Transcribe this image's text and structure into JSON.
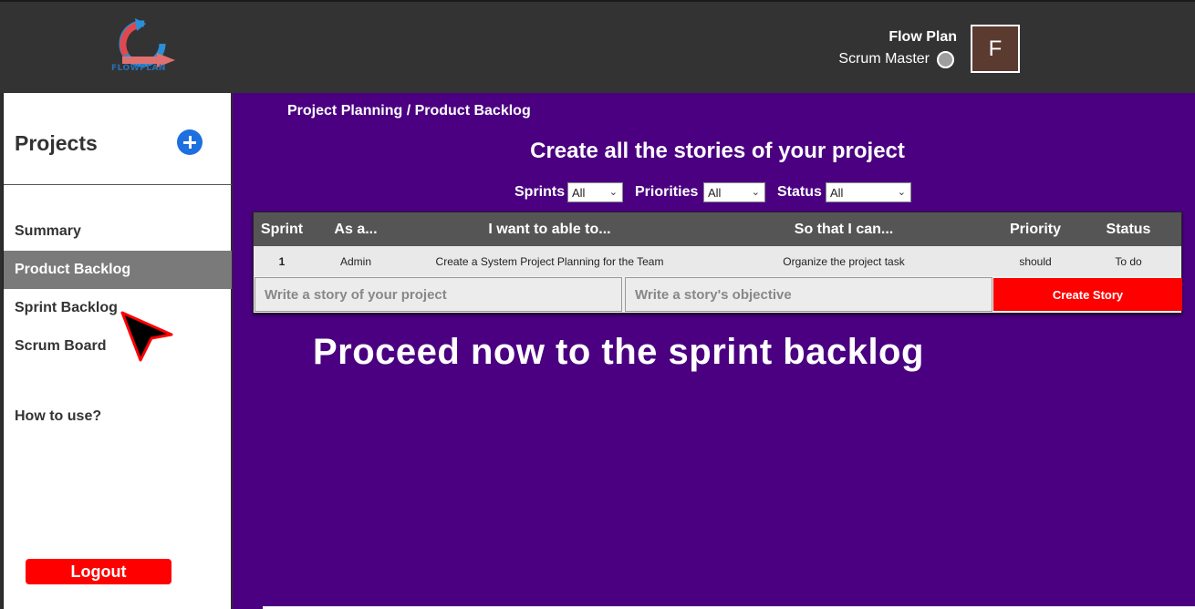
{
  "app": {
    "logo_text": "FLOWPLAN"
  },
  "header": {
    "user_name": "Flow Plan",
    "user_role": "Scrum Master",
    "avatar_letter": "F"
  },
  "sidebar": {
    "title": "Projects",
    "items": [
      {
        "label": "Summary"
      },
      {
        "label": "Product Backlog"
      },
      {
        "label": "Sprint Backlog"
      },
      {
        "label": "Scrum Board"
      }
    ],
    "how_to": "How to use?",
    "logout": "Logout"
  },
  "main": {
    "breadcrumb": "Project Planning / Product Backlog",
    "heading": "Create all the stories of your project",
    "filters": [
      {
        "label": "Sprints",
        "value": "All"
      },
      {
        "label": "Priorities",
        "value": "All"
      },
      {
        "label": "Status",
        "value": "All"
      }
    ],
    "table": {
      "columns": [
        "Sprint",
        "As a...",
        "I want to able to...",
        "So that I can...",
        "Priority",
        "Status"
      ],
      "rows": [
        [
          "1",
          "Admin",
          "Create a System Project Planning for the Team",
          "Organize the project task",
          "should",
          "To do"
        ]
      ]
    },
    "story_placeholder": "Write a story of your project",
    "objective_placeholder": "Write a story's objective",
    "create_button": "Create Story",
    "overlay_text": "Proceed now to the sprint backlog"
  },
  "colors": {
    "topbar": "#333333",
    "main_bg": "#4a0080",
    "accent_red": "#ff0000",
    "add_blue": "#1e6fe0",
    "active_nav": "#7a7a7a"
  }
}
